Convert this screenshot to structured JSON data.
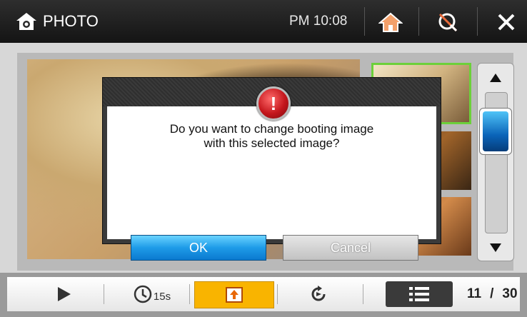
{
  "header": {
    "title": "PHOTO",
    "time": "PM 10:08",
    "icons": [
      "camera-icon",
      "home-icon",
      "no-rotate-icon",
      "close-icon"
    ]
  },
  "dialog": {
    "message_line1": "Do you want to change booting image",
    "message_line2": "with this selected image?",
    "ok_label": "OK",
    "cancel_label": "Cancel"
  },
  "toolbar": {
    "interval": "15s",
    "current": "11",
    "slash": "/",
    "total": "30"
  },
  "colors": {
    "accent_blue": "#1e9be8",
    "upload_orange": "#f9b400",
    "selected_thumb": "#6cd03a",
    "alert_red": "#c4161c"
  }
}
